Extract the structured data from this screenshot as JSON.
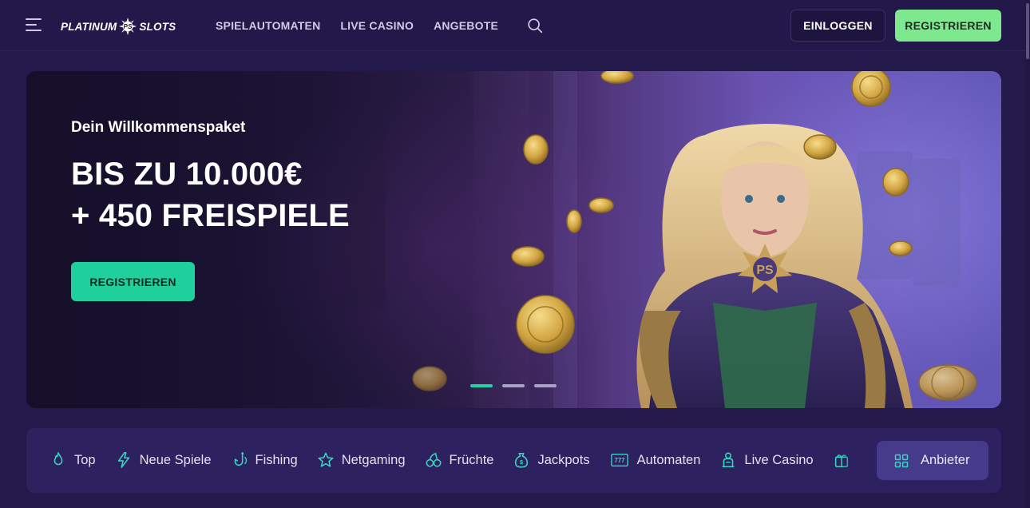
{
  "header": {
    "logo_left": "PLATINUM",
    "logo_right": "SLOTS",
    "nav": [
      {
        "label": "SPIELAUTOMATEN"
      },
      {
        "label": "LIVE CASINO"
      },
      {
        "label": "ANGEBOTE"
      }
    ],
    "login_label": "EINLOGGEN",
    "register_label": "REGISTRIEREN"
  },
  "hero": {
    "subtitle": "Dein Willkommenspaket",
    "title_line1": "BIS ZU 10.000€",
    "title_line2": "+ 450 FREISPIELE",
    "cta_label": "REGISTRIEREN",
    "slides_total": 3,
    "active_slide": 1
  },
  "categories": [
    {
      "label": "Top",
      "icon": "flame-icon"
    },
    {
      "label": "Neue Spiele",
      "icon": "lightning-icon"
    },
    {
      "label": "Fishing",
      "icon": "fishing-hook-icon"
    },
    {
      "label": "Netgaming",
      "icon": "star-icon"
    },
    {
      "label": "Früchte",
      "icon": "cherries-icon"
    },
    {
      "label": "Jackpots",
      "icon": "money-bag-icon"
    },
    {
      "label": "Automaten",
      "icon": "triple-seven-icon",
      "icon_text": "777"
    },
    {
      "label": "Live Casino",
      "icon": "dealer-icon"
    }
  ],
  "providers_label": "Anbieter",
  "colors": {
    "accent_green": "#7ee88f",
    "cta_teal": "#1fcf9c",
    "background": "#23194a",
    "category_bar": "#2d2160",
    "icon_teal": "#38d6c0"
  }
}
